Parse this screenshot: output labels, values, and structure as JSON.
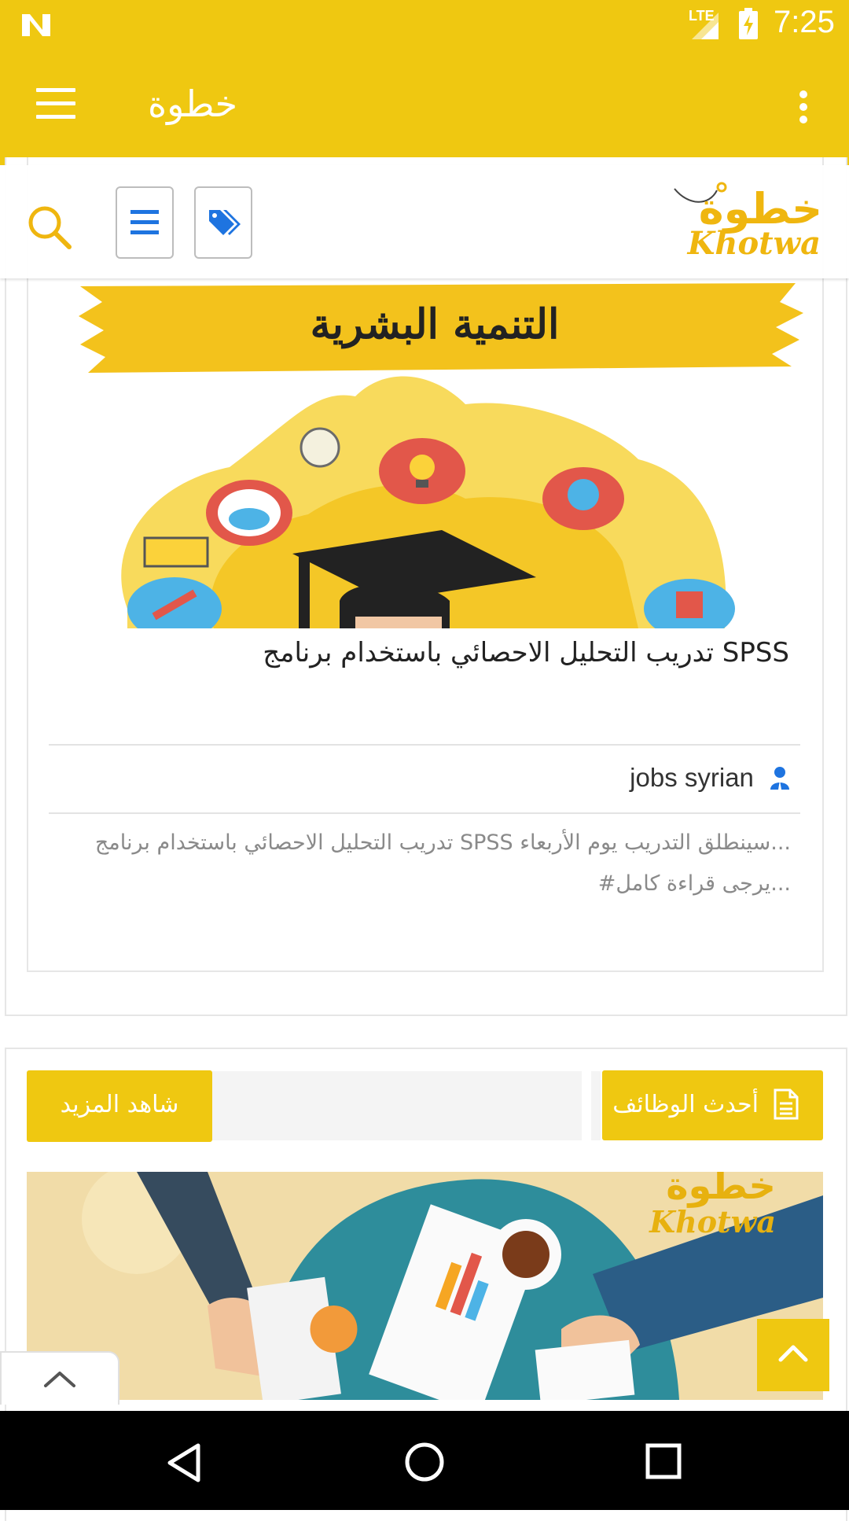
{
  "status_bar": {
    "network": "LTE",
    "time": "7:25"
  },
  "app_bar": {
    "title": "خطوة"
  },
  "site": {
    "logo_arabic": "خطوة",
    "logo_latin": "Khotwa"
  },
  "post": {
    "image_caption": "التنمية البشرية",
    "title": "تدريب التحليل الاحصائي باستخدام برنامج SPSS",
    "author": "jobs syrian",
    "excerpt_line1": "تدريب  التحليل الاحصائي باستخدام برنامج  SPSS سينطلق التدريب يوم الأربعاء...",
    "excerpt_line2": "#يرجى قراءة كامل..."
  },
  "jobs_section": {
    "title": "أحدث الوظائف",
    "more_label": "شاهد المزيد",
    "image_logo_arabic": "خطوة",
    "image_logo_latin": "Khotwa"
  },
  "colors": {
    "brand_yellow": "#efc811",
    "accent_blue": "#1e74e0"
  }
}
